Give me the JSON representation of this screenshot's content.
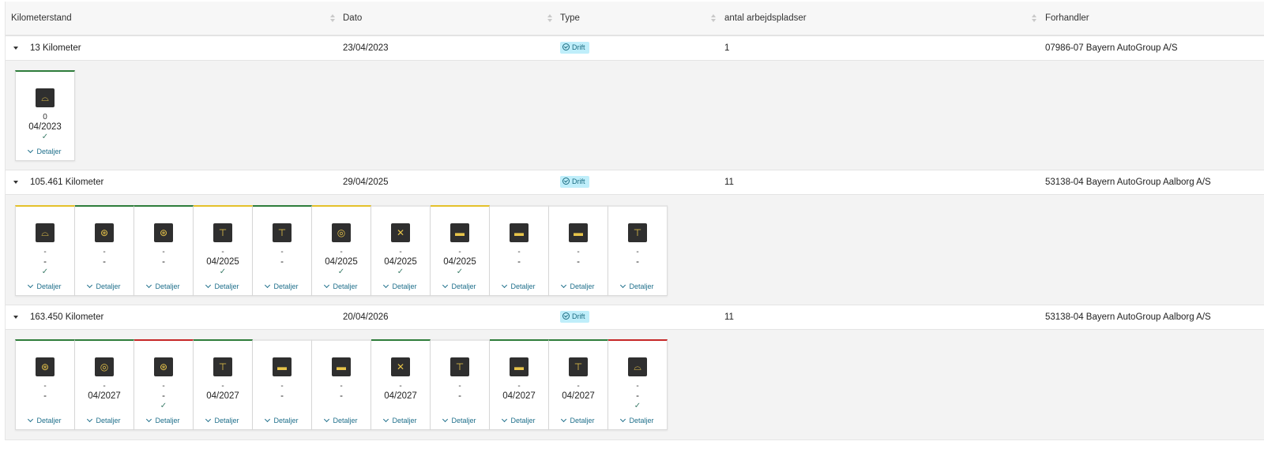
{
  "headers": {
    "kilometerstand": "Kilometerstand",
    "dato": "Dato",
    "type": "Type",
    "arbejdspladser": "antal arbejdspladser",
    "forhandler": "Forhandler"
  },
  "rows": [
    {
      "km": "13 Kilometer",
      "dato": "23/04/2023",
      "type": "Drift",
      "antal": "1",
      "forhandler": "07986-07 Bayern AutoGroup A/S",
      "cards": [
        {
          "status": "green",
          "icon": "car-icon",
          "glyph": "⌓",
          "line1": "0",
          "line2": "04/2023",
          "check": "✓",
          "details": "Detaljer"
        }
      ]
    },
    {
      "km": "105.461 Kilometer",
      "dato": "29/04/2025",
      "type": "Drift",
      "antal": "11",
      "forhandler": "53138-04 Bayern AutoGroup Aalborg A/S",
      "cards": [
        {
          "status": "yellow",
          "icon": "car-icon",
          "glyph": "⌓",
          "line1": "-",
          "line2": "-",
          "check": "✓",
          "details": "Detaljer"
        },
        {
          "status": "green",
          "icon": "brake-warning-icon",
          "glyph": "⊛",
          "line1": "-",
          "line2": "-",
          "check": "",
          "details": "Detaljer"
        },
        {
          "status": "green",
          "icon": "brake-pedal-icon",
          "glyph": "⊛",
          "line1": "-",
          "line2": "-",
          "check": "",
          "details": "Detaljer"
        },
        {
          "status": "yellow",
          "icon": "lift-icon",
          "glyph": "⊤",
          "line1": "-",
          "line2": "04/2025",
          "check": "✓",
          "details": "Detaljer"
        },
        {
          "status": "green",
          "icon": "lift-icon",
          "glyph": "⊤",
          "line1": "-",
          "line2": "-",
          "check": "",
          "details": "Detaljer"
        },
        {
          "status": "yellow",
          "icon": "tire-icon",
          "glyph": "◎",
          "line1": "-",
          "line2": "04/2025",
          "check": "✓",
          "details": "Detaljer"
        },
        {
          "status": "none",
          "icon": "tools-icon",
          "glyph": "✕",
          "line1": "-",
          "line2": "04/2025",
          "check": "✓",
          "details": "Detaljer"
        },
        {
          "status": "yellow",
          "icon": "oil-icon",
          "glyph": "▬",
          "line1": "-",
          "line2": "04/2025",
          "check": "✓",
          "details": "Detaljer"
        },
        {
          "status": "none",
          "icon": "engine-icon",
          "glyph": "▬",
          "line1": "-",
          "line2": "-",
          "check": "",
          "details": "Detaljer"
        },
        {
          "status": "none",
          "icon": "engine-icon",
          "glyph": "▬",
          "line1": "-",
          "line2": "-",
          "check": "",
          "details": "Detaljer"
        },
        {
          "status": "none",
          "icon": "lift-icon",
          "glyph": "⊤",
          "line1": "-",
          "line2": "-",
          "check": "",
          "details": "Detaljer"
        }
      ]
    },
    {
      "km": "163.450 Kilometer",
      "dato": "20/04/2026",
      "type": "Drift",
      "antal": "11",
      "forhandler": "53138-04 Bayern AutoGroup Aalborg A/S",
      "cards": [
        {
          "status": "green",
          "icon": "brake-warning-icon",
          "glyph": "⊛",
          "line1": "-",
          "line2": "-",
          "check": "",
          "details": "Detaljer"
        },
        {
          "status": "green",
          "icon": "tire-icon",
          "glyph": "◎",
          "line1": "-",
          "line2": "04/2027",
          "check": "",
          "details": "Detaljer"
        },
        {
          "status": "red",
          "icon": "brake-pedal-icon",
          "glyph": "⊛",
          "line1": "-",
          "line2": "-",
          "check": "✓",
          "details": "Detaljer"
        },
        {
          "status": "green",
          "icon": "lift-icon",
          "glyph": "⊤",
          "line1": "-",
          "line2": "04/2027",
          "check": "",
          "details": "Detaljer"
        },
        {
          "status": "none",
          "icon": "engine-icon",
          "glyph": "▬",
          "line1": "-",
          "line2": "-",
          "check": "",
          "details": "Detaljer"
        },
        {
          "status": "none",
          "icon": "engine-icon",
          "glyph": "▬",
          "line1": "-",
          "line2": "-",
          "check": "",
          "details": "Detaljer"
        },
        {
          "status": "green",
          "icon": "tools-icon",
          "glyph": "✕",
          "line1": "-",
          "line2": "04/2027",
          "check": "",
          "details": "Detaljer"
        },
        {
          "status": "none",
          "icon": "lift-icon",
          "glyph": "⊤",
          "line1": "-",
          "line2": "-",
          "check": "",
          "details": "Detaljer"
        },
        {
          "status": "green",
          "icon": "oil-icon",
          "glyph": "▬",
          "line1": "-",
          "line2": "04/2027",
          "check": "",
          "details": "Detaljer"
        },
        {
          "status": "green",
          "icon": "lift-icon",
          "glyph": "⊤",
          "line1": "-",
          "line2": "04/2027",
          "check": "",
          "details": "Detaljer"
        },
        {
          "status": "red",
          "icon": "car-icon",
          "glyph": "⌓",
          "line1": "-",
          "line2": "-",
          "check": "✓",
          "details": "Detaljer"
        }
      ]
    }
  ]
}
